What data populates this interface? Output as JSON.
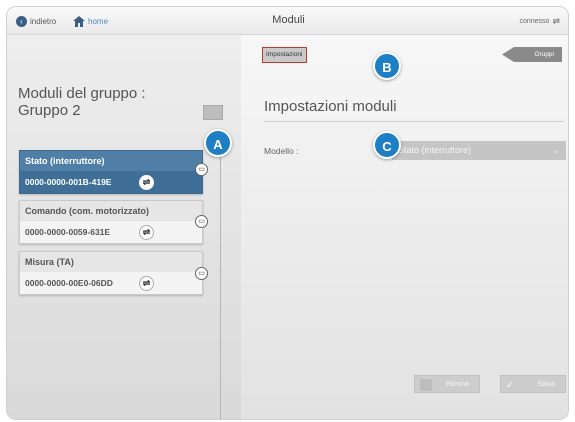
{
  "topbar": {
    "back_label": "indietro",
    "home_label": "home",
    "title": "Moduli",
    "status": "connesso"
  },
  "left": {
    "group_title": "Moduli del gruppo : Gruppo 2",
    "modules": [
      {
        "name": "Stato (interruttore)",
        "id": "0000-0000-001B-419E",
        "selected": true
      },
      {
        "name": "Comando (com. motorizzato)",
        "id": "0000-0000-0059-631E",
        "selected": false
      },
      {
        "name": "Misura (TA)",
        "id": "0000-0000-00E0-06DD",
        "selected": false
      }
    ]
  },
  "right": {
    "tab_settings": "Impostazioni",
    "tab_groups": "Gruppi",
    "section_title": "Impostazioni moduli",
    "model_label": "Modello :",
    "model_value": "Stato (interruttore)",
    "delete_label": "Elimina",
    "save_label": "Salva"
  },
  "callouts": [
    "A",
    "B",
    "C"
  ],
  "colors": {
    "accent": "#1f7fc4",
    "selected_module": "#4f7ea6",
    "active_tab_border": "#c0392b"
  },
  "icons": [
    "back-icon",
    "home-icon",
    "usb-icon",
    "edit-icon",
    "link-icon",
    "delete-icon",
    "check-icon",
    "chevron-down-icon"
  ]
}
